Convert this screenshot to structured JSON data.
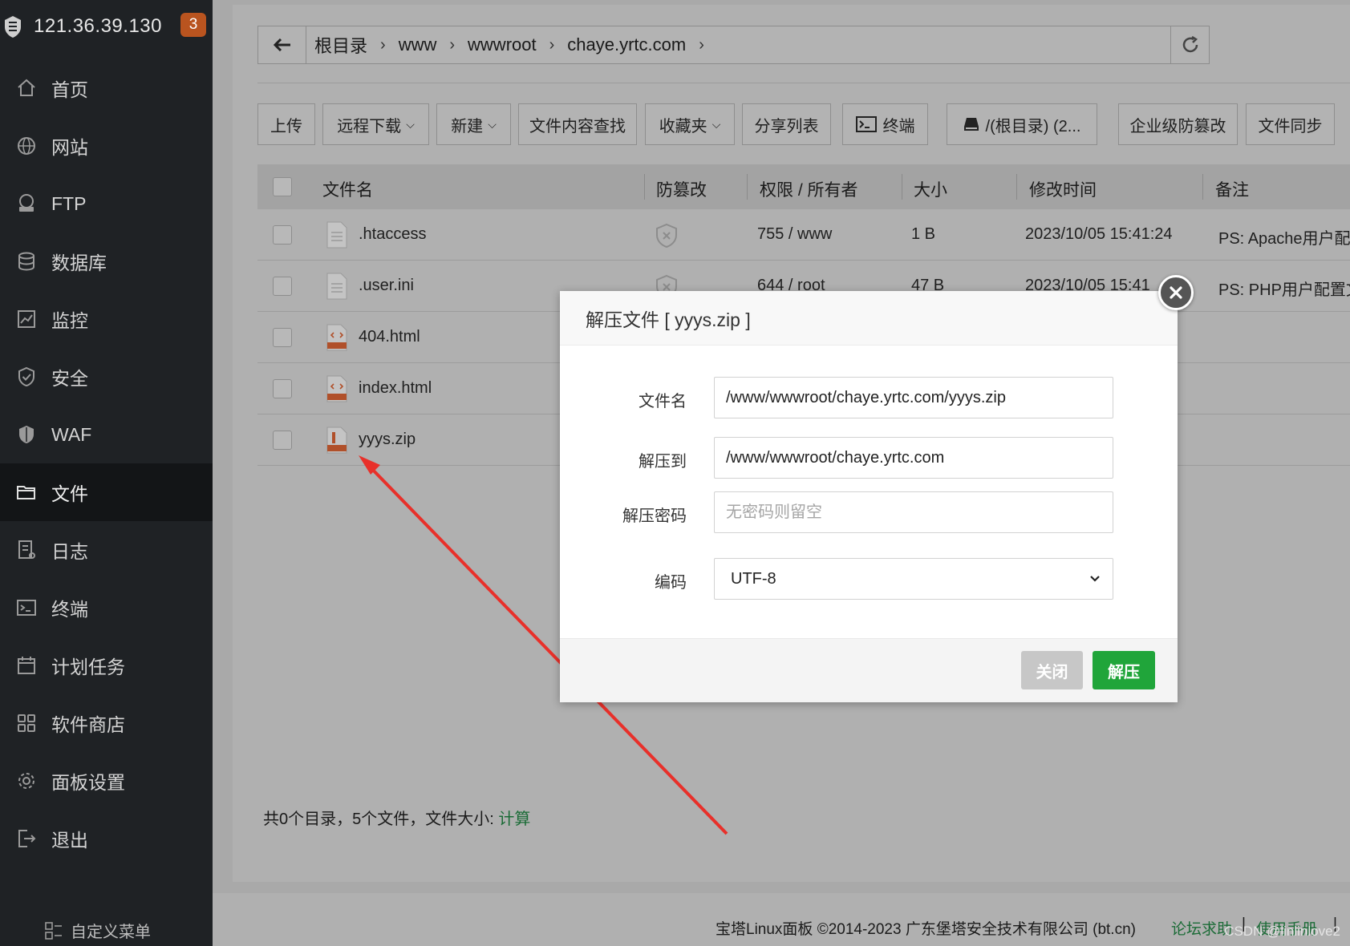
{
  "server": {
    "ip": "121.36.39.130",
    "badge_count": "3"
  },
  "sidebar": {
    "items": [
      {
        "label": "首页",
        "icon": "home-icon"
      },
      {
        "label": "网站",
        "icon": "globe-icon"
      },
      {
        "label": "FTP",
        "icon": "ftp-icon"
      },
      {
        "label": "数据库",
        "icon": "database-icon"
      },
      {
        "label": "监控",
        "icon": "monitor-icon"
      },
      {
        "label": "安全",
        "icon": "shield-check-icon"
      },
      {
        "label": "WAF",
        "icon": "waf-shield-icon"
      },
      {
        "label": "文件",
        "icon": "folder-icon",
        "active": true
      },
      {
        "label": "日志",
        "icon": "log-icon"
      },
      {
        "label": "终端",
        "icon": "terminal-icon"
      },
      {
        "label": "计划任务",
        "icon": "calendar-icon"
      },
      {
        "label": "软件商店",
        "icon": "grid-icon"
      },
      {
        "label": "面板设置",
        "icon": "gear-icon"
      },
      {
        "label": "退出",
        "icon": "logout-icon"
      }
    ],
    "custom_menu": "自定义菜单"
  },
  "breadcrumb": [
    "根目录",
    "www",
    "wwwroot",
    "chaye.yrtc.com"
  ],
  "toolbar": {
    "upload": "上传",
    "remote_download": "远程下载",
    "new": "新建",
    "content_search": "文件内容查找",
    "favorites": "收藏夹",
    "share_list": "分享列表",
    "terminal": "终端",
    "disk": "/(根目录) (2...",
    "tamper_proof": "企业级防篡改",
    "file_sync": "文件同步"
  },
  "table": {
    "headers": [
      "文件名",
      "防篡改",
      "权限 / 所有者",
      "大小",
      "修改时间",
      "备注"
    ],
    "rows": [
      {
        "name": ".htaccess",
        "type": "text",
        "perm": "755 / www",
        "size": "1 B",
        "mtime": "2023/10/05 15:41:24",
        "note": "PS: Apache用户配"
      },
      {
        "name": ".user.ini",
        "type": "text",
        "perm": "644 / root",
        "size": "47 B",
        "mtime": "2023/10/05 15:41",
        "note": "PS: PHP用户配置文"
      },
      {
        "name": "404.html",
        "type": "html",
        "perm": "",
        "size": "",
        "mtime": "",
        "note": ""
      },
      {
        "name": "index.html",
        "type": "html",
        "perm": "",
        "size": "",
        "mtime": "",
        "note": ""
      },
      {
        "name": "yyys.zip",
        "type": "zip",
        "perm": "",
        "size": "",
        "mtime": "",
        "note": ""
      }
    ]
  },
  "summary": {
    "text": "共0个目录，5个文件，文件大小:",
    "calc": "计算"
  },
  "footer": {
    "copyright": "宝塔Linux面板 ©2014-2023 广东堡塔安全技术有限公司 (bt.cn)",
    "forum": "论坛求助",
    "manual": "使用手册",
    "watermark": "CSDN @linlinlove2"
  },
  "modal": {
    "title": "解压文件 [ yyys.zip ]",
    "fields": {
      "filename_label": "文件名",
      "filename_value": "/www/wwwroot/chaye.yrtc.com/yyys.zip",
      "dest_label": "解压到",
      "dest_value": "/www/wwwroot/chaye.yrtc.com",
      "password_label": "解压密码",
      "password_placeholder": "无密码则留空",
      "encoding_label": "编码",
      "encoding_value": "UTF-8"
    },
    "close_button": "关闭",
    "extract_button": "解压"
  },
  "colors": {
    "accent_green": "#20a53a",
    "badge_orange": "#b9541f",
    "annotation_red": "#e8302a"
  }
}
